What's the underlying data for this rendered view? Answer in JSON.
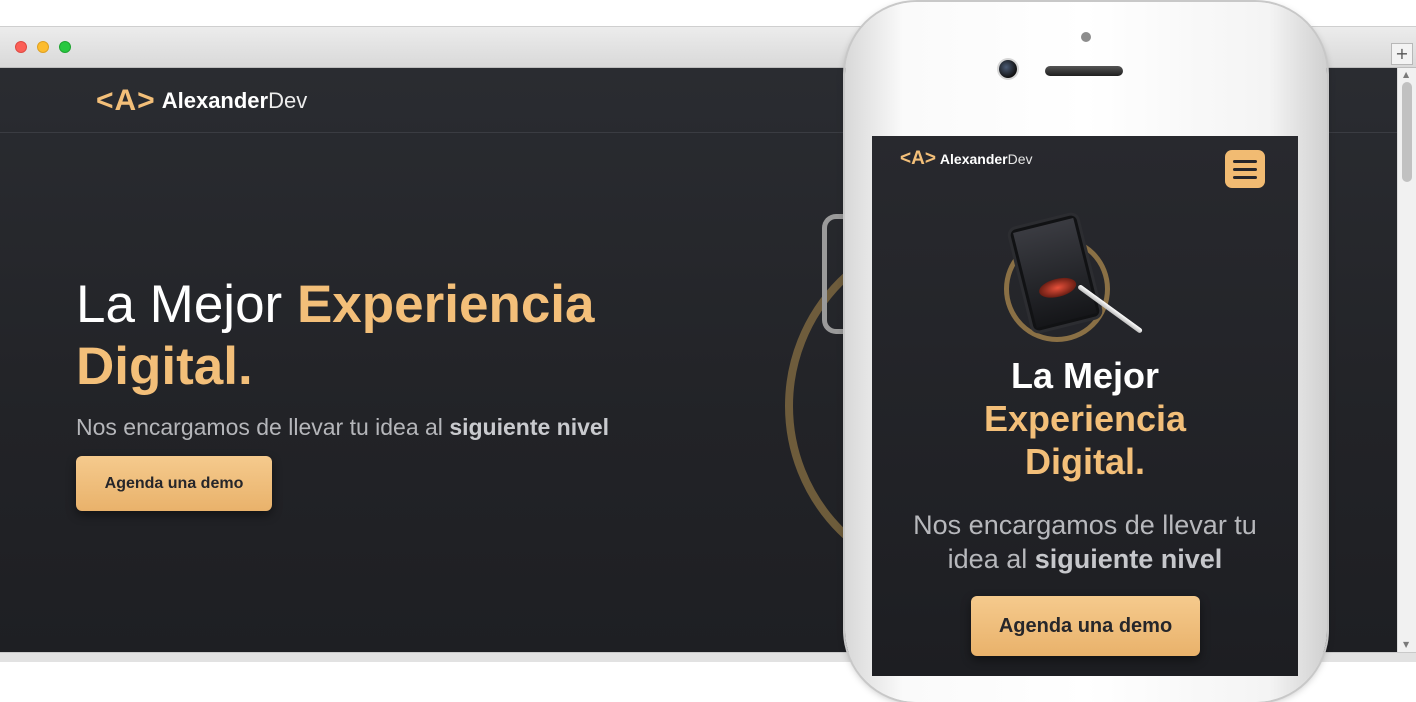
{
  "desktop": {
    "logo": {
      "mark": "<A>",
      "brand": "Alexander",
      "brand_suffix": "Dev"
    },
    "hero": {
      "title_plain": "La Mejor ",
      "title_accent": "Experiencia Digital.",
      "subtitle_plain": "Nos encargamos de llevar tu idea al ",
      "subtitle_bold": "siguiente nivel",
      "cta_label": "Agenda una demo"
    },
    "new_tab_symbol": "+"
  },
  "mobile": {
    "logo": {
      "mark": "<A>",
      "brand": "Alexander",
      "brand_suffix": "Dev"
    },
    "menu_icon": "hamburger-icon",
    "hero": {
      "title_plain": "La Mejor",
      "title_accent_line1": "Experiencia",
      "title_accent_line2": "Digital.",
      "subtitle_plain": "Nos encargamos de llevar tu idea al ",
      "subtitle_bold": "siguiente nivel",
      "cta_label": "Agenda una demo"
    }
  },
  "colors": {
    "accent": "#f3bf79",
    "background": "#222327",
    "button": "#eebd7b",
    "button_text": "#26262a"
  }
}
